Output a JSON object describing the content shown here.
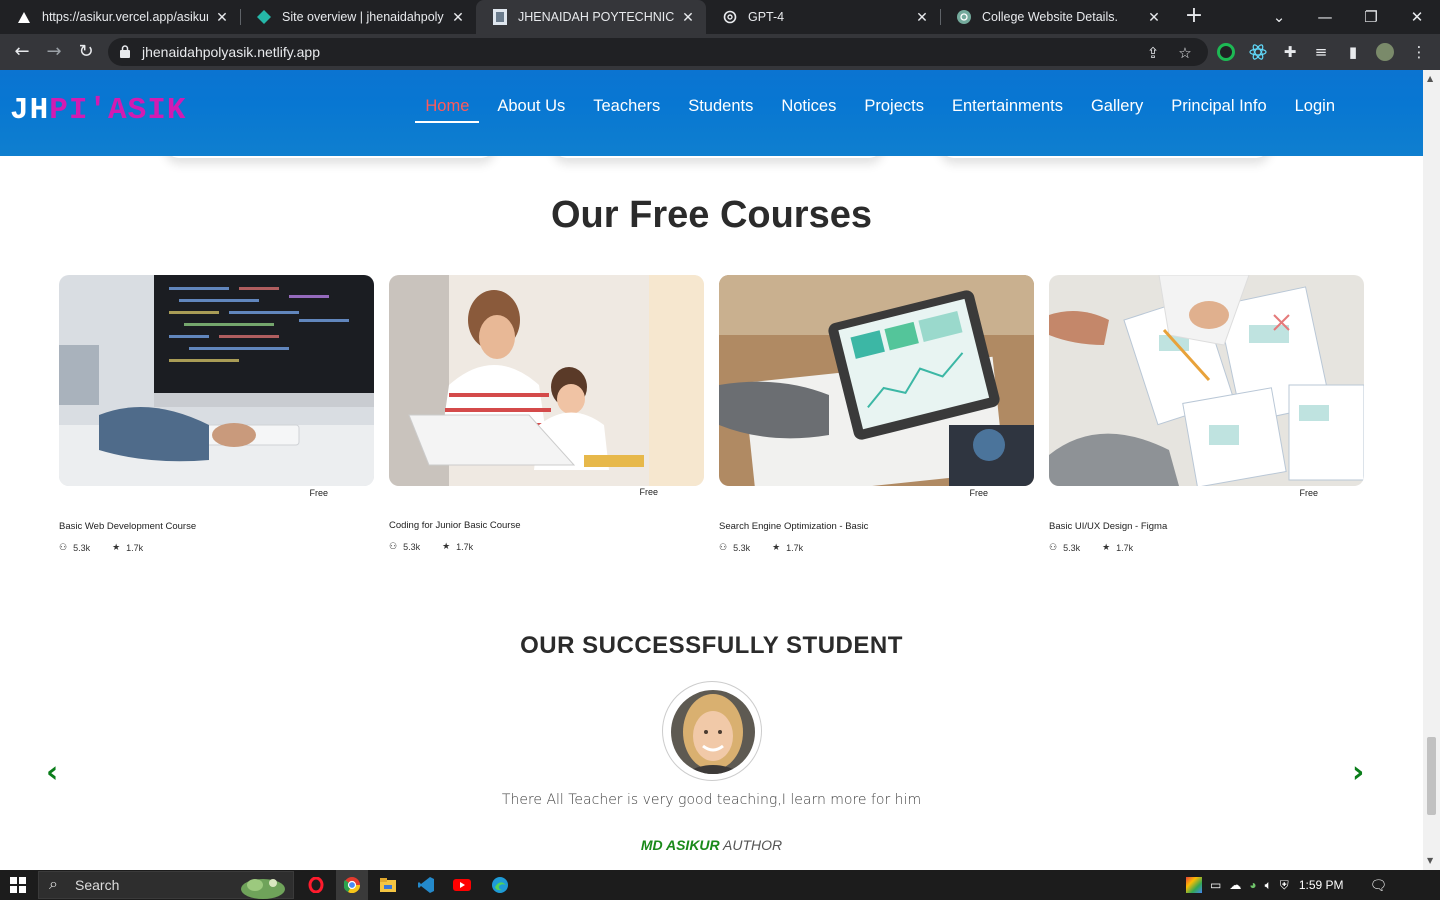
{
  "browser": {
    "tabs": [
      {
        "title": "https://asikur.vercel.app/asikur/",
        "icon": "vercel-icon"
      },
      {
        "title": "Site overview | jhenaidahpolyasik",
        "icon": "netlify-icon"
      },
      {
        "title": "JHENAIDAH POYTECHNIC INSTI",
        "icon": "site-favicon",
        "active": true
      },
      {
        "title": "GPT-4",
        "icon": "openai-icon"
      },
      {
        "title": "College Website Details.",
        "icon": "chatgpt-icon"
      }
    ],
    "url": "jhenaidahpolyasik.netlify.app"
  },
  "site": {
    "logo_part1": "JH",
    "logo_part2": "PI'ASIK",
    "menu": [
      "Home",
      "About Us",
      "Teachers",
      "Students",
      "Notices",
      "Projects",
      "Entertainments",
      "Gallery",
      "Principal Info",
      "Login"
    ],
    "active_menu": "Home",
    "accent_colors": {
      "nav": "#0b74d1",
      "logo_pink": "#d21bb2",
      "active_link": "#ff5a5a",
      "green": "#1a8a1a"
    }
  },
  "courses": {
    "title": "Our Free Courses",
    "items": [
      {
        "name": "Basic Web Development Course",
        "price": "Free",
        "students": "5.3k",
        "rating": "1.7k"
      },
      {
        "name": "Coding for Junior Basic Course",
        "price": "Free",
        "students": "5.3k",
        "rating": "1.7k"
      },
      {
        "name": "Search Engine Optimization - Basic",
        "price": "Free",
        "students": "5.3k",
        "rating": "1.7k"
      },
      {
        "name": "Basic UI/UX Design - Figma",
        "price": "Free",
        "students": "5.3k",
        "rating": "1.7k"
      }
    ]
  },
  "testimonial": {
    "title": "OUR SUCCESSFULLY STUDENT",
    "quote": "There All Teacher is very good teaching,I learn more for him",
    "author_name": "MD ASIKUR",
    "author_role": "AUTHOR"
  },
  "taskbar": {
    "search_placeholder": "Search",
    "time": "1:59 PM"
  }
}
